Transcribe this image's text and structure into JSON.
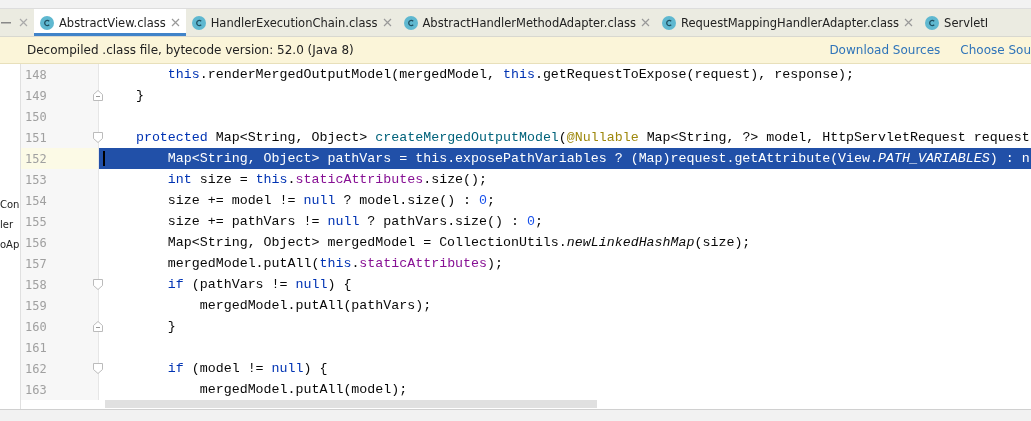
{
  "tabs": [
    {
      "label": "AbstractView.class",
      "selected": true,
      "closable": true
    },
    {
      "label": "HandlerExecutionChain.class",
      "selected": false,
      "closable": true
    },
    {
      "label": "AbstractHandlerMethodAdapter.class",
      "selected": false,
      "closable": true
    },
    {
      "label": "RequestMappingHandlerAdapter.class",
      "selected": false,
      "closable": true
    },
    {
      "label": "ServletI",
      "selected": false,
      "closable": false
    }
  ],
  "notice": {
    "text": "Decompiled .class file, bytecode version: 52.0 (Java 8)",
    "links": [
      "Download Sources",
      "Choose Sou"
    ]
  },
  "sidebar": {
    "items": [
      "Con",
      "ler",
      "oAp"
    ]
  },
  "editor": {
    "lines": [
      {
        "number": "148",
        "fold_start": false,
        "fold_end": false,
        "selected": false,
        "tokens": [
          {
            "kind": "keyword",
            "text": "        this"
          },
          {
            "kind": "plain",
            "text": ".renderMergedOutputModel(mergedModel, "
          },
          {
            "kind": "keyword",
            "text": "this"
          },
          {
            "kind": "plain",
            "text": ".getRequestToExpose(request), response);"
          }
        ]
      },
      {
        "number": "149",
        "fold_start": false,
        "fold_end": true,
        "selected": false,
        "tokens": [
          {
            "kind": "plain",
            "text": "    }"
          }
        ]
      },
      {
        "number": "150",
        "fold_start": false,
        "fold_end": false,
        "selected": false
      },
      {
        "number": "151",
        "fold_start": true,
        "fold_end": false,
        "selected": false,
        "tokens": [
          {
            "kind": "keyword",
            "text": "    protected"
          },
          {
            "kind": "plain",
            "text": " Map<String, Object> "
          },
          {
            "kind": "declaration",
            "text": "createMergedOutputModel"
          },
          {
            "kind": "plain",
            "text": "("
          },
          {
            "kind": "annotation",
            "text": "@Nullable"
          },
          {
            "kind": "plain",
            "text": " Map<String, ?> model, HttpServletRequest request"
          }
        ]
      },
      {
        "number": "152",
        "fold_start": false,
        "fold_end": false,
        "selected": true,
        "tokens": [
          {
            "kind": "plain",
            "text": "        Map<String, Object> pathVars = "
          },
          {
            "kind": "keyword",
            "text": "this"
          },
          {
            "kind": "plain",
            "text": ".exposePathVariables ? (Map)request.getAttribute(View."
          },
          {
            "kind": "constant",
            "text": "PATH_VARIABLES"
          },
          {
            "kind": "plain",
            "text": ") : n"
          }
        ]
      },
      {
        "number": "153",
        "fold_start": false,
        "fold_end": false,
        "selected": false,
        "tokens": [
          {
            "kind": "keyword",
            "text": "        int"
          },
          {
            "kind": "plain",
            "text": " size = "
          },
          {
            "kind": "keyword",
            "text": "this"
          },
          {
            "kind": "plain",
            "text": "."
          },
          {
            "kind": "field",
            "text": "staticAttributes"
          },
          {
            "kind": "plain",
            "text": ".size();"
          }
        ]
      },
      {
        "number": "154",
        "fold_start": false,
        "fold_end": false,
        "selected": false,
        "tokens": [
          {
            "kind": "plain",
            "text": "        size += model != "
          },
          {
            "kind": "keyword",
            "text": "null"
          },
          {
            "kind": "plain",
            "text": " ? model.size() : "
          },
          {
            "kind": "number",
            "text": "0"
          },
          {
            "kind": "plain",
            "text": ";"
          }
        ]
      },
      {
        "number": "155",
        "fold_start": false,
        "fold_end": false,
        "selected": false,
        "tokens": [
          {
            "kind": "plain",
            "text": "        size += pathVars != "
          },
          {
            "kind": "keyword",
            "text": "null"
          },
          {
            "kind": "plain",
            "text": " ? pathVars.size() : "
          },
          {
            "kind": "number",
            "text": "0"
          },
          {
            "kind": "plain",
            "text": ";"
          }
        ]
      },
      {
        "number": "156",
        "fold_start": false,
        "fold_end": false,
        "selected": false,
        "tokens": [
          {
            "kind": "plain",
            "text": "        Map<String, Object> mergedModel = CollectionUtils."
          },
          {
            "kind": "static",
            "text": "newLinkedHashMap"
          },
          {
            "kind": "plain",
            "text": "(size);"
          }
        ]
      },
      {
        "number": "157",
        "fold_start": false,
        "fold_end": false,
        "selected": false,
        "tokens": [
          {
            "kind": "plain",
            "text": "        mergedModel.putAll("
          },
          {
            "kind": "keyword",
            "text": "this"
          },
          {
            "kind": "plain",
            "text": "."
          },
          {
            "kind": "field",
            "text": "staticAttributes"
          },
          {
            "kind": "plain",
            "text": ");"
          }
        ]
      },
      {
        "number": "158",
        "fold_start": true,
        "fold_end": false,
        "selected": false,
        "tokens": [
          {
            "kind": "keyword",
            "text": "        if"
          },
          {
            "kind": "plain",
            "text": " (pathVars != "
          },
          {
            "kind": "keyword",
            "text": "null"
          },
          {
            "kind": "plain",
            "text": ") {"
          }
        ]
      },
      {
        "number": "159",
        "fold_start": false,
        "fold_end": false,
        "selected": false,
        "tokens": [
          {
            "kind": "plain",
            "text": "            mergedModel.putAll(pathVars);"
          }
        ]
      },
      {
        "number": "160",
        "fold_start": false,
        "fold_end": true,
        "selected": false,
        "tokens": [
          {
            "kind": "plain",
            "text": "        }"
          }
        ]
      },
      {
        "number": "161",
        "fold_start": false,
        "fold_end": false,
        "selected": false
      },
      {
        "number": "162",
        "fold_start": true,
        "fold_end": false,
        "selected": false,
        "tokens": [
          {
            "kind": "keyword",
            "text": "        if"
          },
          {
            "kind": "plain",
            "text": " (model != "
          },
          {
            "kind": "keyword",
            "text": "null"
          },
          {
            "kind": "plain",
            "text": ") {"
          }
        ]
      },
      {
        "number": "163",
        "fold_start": false,
        "fold_end": false,
        "selected": false,
        "tokens": [
          {
            "kind": "plain",
            "text": "            mergedModel.putAll(model);"
          }
        ]
      }
    ]
  }
}
